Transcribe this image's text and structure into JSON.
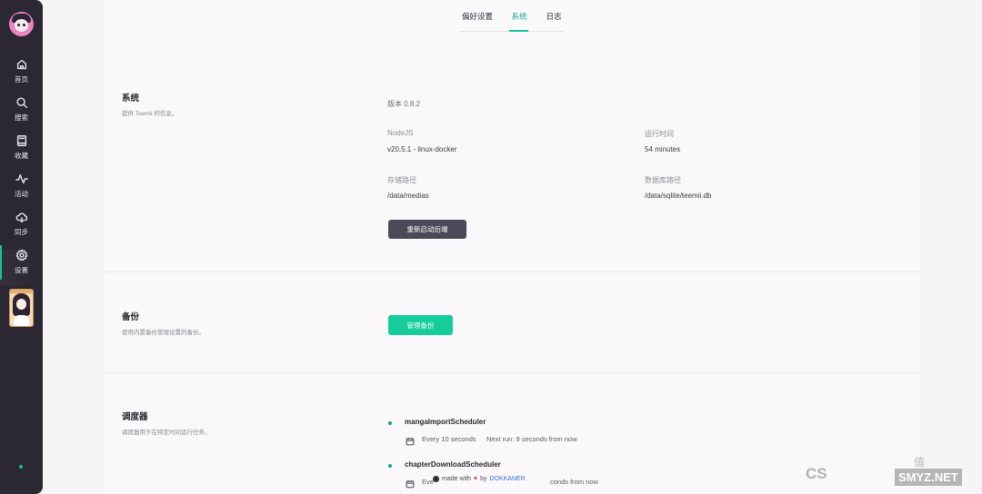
{
  "sidebar": {
    "items": [
      {
        "key": "home",
        "label": "首页",
        "icon": "home-icon"
      },
      {
        "key": "search",
        "label": "搜索",
        "icon": "search-icon"
      },
      {
        "key": "collection",
        "label": "收藏",
        "icon": "book-icon"
      },
      {
        "key": "activity",
        "label": "活动",
        "icon": "activity-icon"
      },
      {
        "key": "sync",
        "label": "同步",
        "icon": "cloud-sync-icon"
      },
      {
        "key": "settings",
        "label": "设置",
        "icon": "gear-icon"
      }
    ],
    "active": "settings",
    "accent_color": "#15c39a"
  },
  "tabs": [
    {
      "label": "偏好设置"
    },
    {
      "label": "系统"
    },
    {
      "label": "日志"
    }
  ],
  "active_tab": "系统",
  "system": {
    "title": "系统",
    "desc": "提供 Teemii 的信息。",
    "version": "版本 0.8.2",
    "nodejs_label": "NodeJS",
    "nodejs_value": "v20.5.1 - linux-docker",
    "uptime_label": "运行时间",
    "uptime_value": "54 minutes",
    "storage_label": "存储路径",
    "storage_value": "/data/medias",
    "db_label": "数据库路径",
    "db_value": "/data/sqlite/teemii.db",
    "restart_button": "重新启动后端"
  },
  "backup": {
    "title": "备份",
    "desc": "使用内置备份管理设置的备份。",
    "manage_button": "管理备份",
    "button_color": "#14cd9b"
  },
  "scheduler": {
    "title": "调度器",
    "desc": "调度器用于在特定时间运行任务。",
    "jobs": [
      {
        "name": "mangaImportScheduler",
        "interval": "Every 10 seconds",
        "next_run": "Next run: 9 seconds from now"
      },
      {
        "name": "chapterDownloadScheduler",
        "interval": "Eve",
        "next_run": "conds from now"
      }
    ]
  },
  "footer": {
    "made_with": "made with",
    "by": "by",
    "brand": "DOKKANER"
  },
  "watermarks": {
    "csdn": "CS",
    "smyz": "SMYZ.NET",
    "zhi": "值"
  }
}
